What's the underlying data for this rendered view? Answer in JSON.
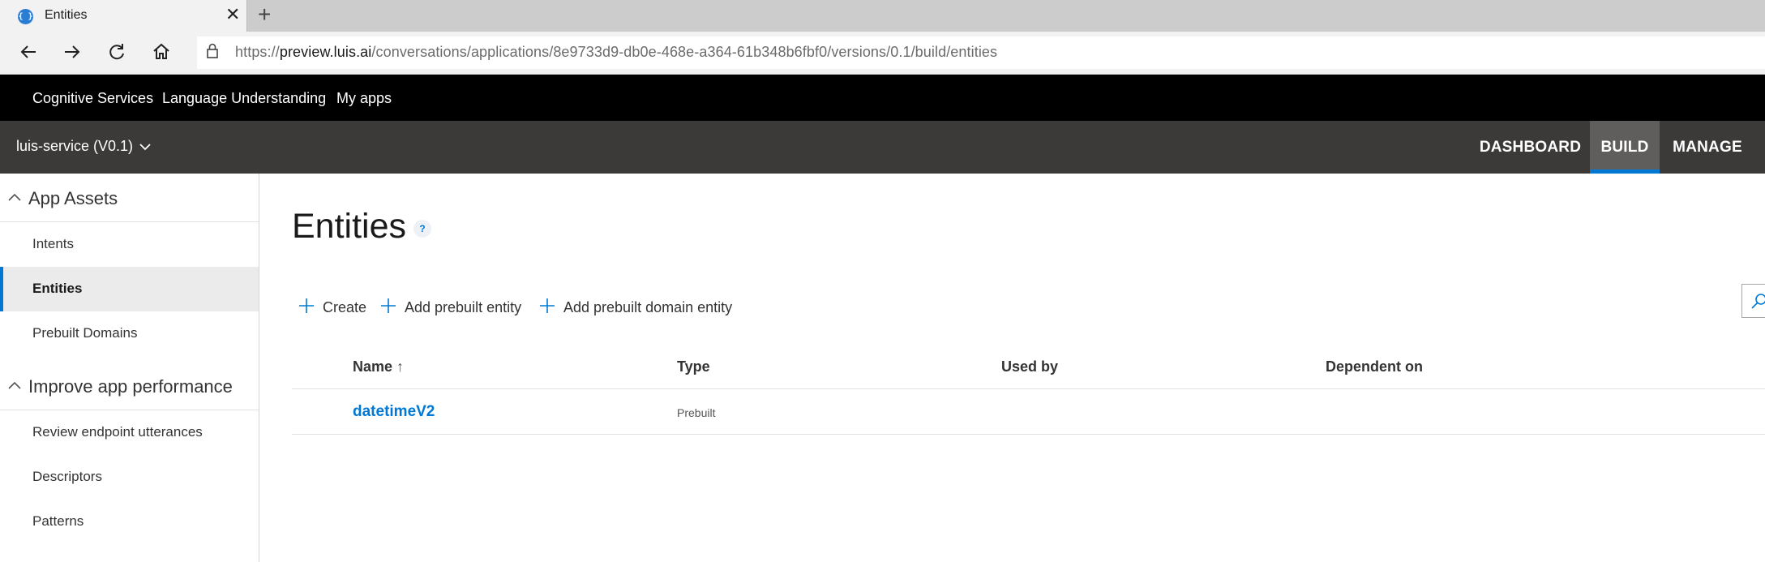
{
  "browser": {
    "tab_title": "Entities",
    "favicon_glyph": "{ }",
    "close_glyph": "✕",
    "newtab_glyph": "+",
    "url_scheme": "https://",
    "url_host": "preview.luis.ai",
    "url_path": "/conversations/applications/8e9733d9-db0e-468e-a364-61b348b6fbf0/versions/0.1/build/entities"
  },
  "topbar": {
    "links": [
      "Cognitive Services",
      "Language Understanding",
      "My apps"
    ]
  },
  "appbar": {
    "app_selector": "luis-service (V0.1)",
    "nav": [
      "DASHBOARD",
      "BUILD",
      "MANAGE"
    ],
    "active_nav": "BUILD",
    "accent_color": "#0078d4"
  },
  "sidebar": {
    "groups": [
      {
        "label": "App Assets",
        "items": [
          "Intents",
          "Entities",
          "Prebuilt Domains"
        ]
      },
      {
        "label": "Improve app performance",
        "items": [
          "Review endpoint utterances",
          "Descriptors",
          "Patterns"
        ]
      }
    ],
    "active_item": "Entities"
  },
  "main": {
    "title": "Entities",
    "help_glyph": "?",
    "commands": [
      "Create",
      "Add prebuilt entity",
      "Add prebuilt domain entity"
    ],
    "table": {
      "columns": [
        "Name",
        "Type",
        "Used by",
        "Dependent on"
      ],
      "sort_glyph": "↑",
      "rows": [
        {
          "name": "datetimeV2",
          "type": "Prebuilt",
          "used_by": "",
          "dependent_on": ""
        }
      ]
    }
  }
}
